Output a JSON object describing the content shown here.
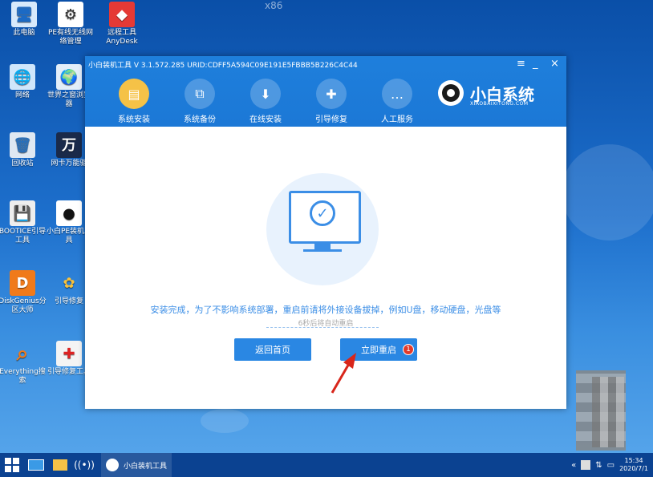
{
  "desktop": {
    "top_label": "x86",
    "icons": [
      {
        "label": "此电脑",
        "glyph": "🖥"
      },
      {
        "label": "PE有线无线网络管理",
        "glyph": "⚙"
      },
      {
        "label": "远程工具AnyDesk",
        "glyph": "◆"
      },
      {
        "label": "网络",
        "glyph": "🌐"
      },
      {
        "label": "世界之窗浏览器",
        "glyph": "🌍"
      },
      {
        "label": "回收站",
        "glyph": "🗑"
      },
      {
        "label": "网卡万能驱",
        "glyph": "万"
      },
      {
        "label": "BOOTICE引导工具",
        "glyph": "💾"
      },
      {
        "label": "小白PE装机工具",
        "glyph": "●"
      },
      {
        "label": "DiskGenius分区大师",
        "glyph": "D"
      },
      {
        "label": "引导修复",
        "glyph": "✿"
      },
      {
        "label": "Everything搜索",
        "glyph": "⌕"
      },
      {
        "label": "引导修复工具",
        "glyph": "✚"
      }
    ]
  },
  "window": {
    "title": "小白装机工具 V 3.1.572.285 URID:CDFF5A594C09E191E5FBBB5B226C4C44",
    "controls": {
      "menu": "≡",
      "minimize": "_",
      "close": "×"
    },
    "nav": [
      {
        "label": "系统安装",
        "glyph": "▤",
        "active": true
      },
      {
        "label": "系统备份",
        "glyph": "⧉",
        "active": false
      },
      {
        "label": "在线安装",
        "glyph": "⬇",
        "active": false
      },
      {
        "label": "引导修复",
        "glyph": "✚",
        "active": false
      },
      {
        "label": "人工服务",
        "glyph": "…",
        "active": false
      }
    ],
    "brand": {
      "name": "小白系统",
      "sub": "XIAOBAIXITONG.COM"
    },
    "message": "安装完成，为了不影响系统部署，重启前请将外接设备拔掉，例如U盘，移动硬盘，光盘等",
    "countdown": "6秒后将自动重启",
    "buttons": {
      "back": "返回首页",
      "restart": "立即重启",
      "badge": "1"
    }
  },
  "taskbar": {
    "app_label": "小白装机工具",
    "time": "15:34",
    "date": "2020/7/1"
  }
}
